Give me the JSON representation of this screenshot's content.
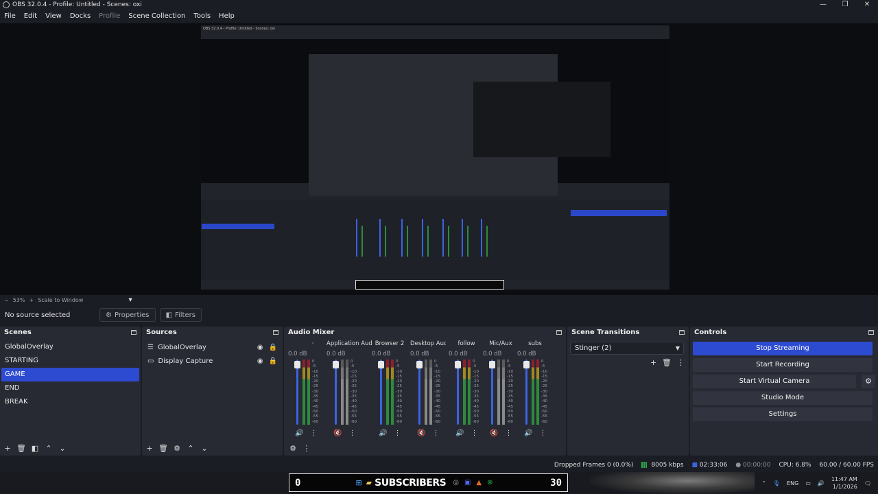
{
  "window": {
    "title": "OBS 32.0.4 - Profile: Untitled - Scenes: oxi",
    "controls": [
      "—",
      "❐",
      "✕"
    ]
  },
  "menu": [
    "File",
    "Edit",
    "View",
    "Docks",
    "Profile",
    "Scene Collection",
    "Tools",
    "Help"
  ],
  "scale": {
    "minus": "−",
    "zoom": "53%",
    "plus": "+",
    "mode": "Scale to Window"
  },
  "properties_bar": {
    "no_source": "No source selected",
    "properties": "Properties",
    "filters": "Filters"
  },
  "scenes": {
    "title": "Scenes",
    "items": [
      "GlobalOverlay",
      "STARTING",
      "GAME",
      "END",
      "BREAK"
    ],
    "selected": "GAME"
  },
  "sources": {
    "title": "Sources",
    "items": [
      {
        "name": "GlobalOverlay",
        "icon": "list-icon"
      },
      {
        "name": "Display Capture",
        "icon": "monitor-icon"
      }
    ]
  },
  "mixer": {
    "title": "Audio Mixer",
    "channels": [
      {
        "name": "·",
        "db": "0.0 dB",
        "muted": false
      },
      {
        "name": "Application Audio C",
        "db": "0.0 dB",
        "muted": true
      },
      {
        "name": "Browser 2",
        "db": "0.0 dB",
        "muted": false
      },
      {
        "name": "Desktop Audio",
        "db": "0.0 dB",
        "muted": true
      },
      {
        "name": "follow",
        "db": "0.0 dB",
        "muted": false
      },
      {
        "name": "Mic/Aux",
        "db": "0.0 dB",
        "muted": true
      },
      {
        "name": "subs",
        "db": "0.0 dB",
        "muted": false
      }
    ],
    "ticks": [
      "0",
      "-5",
      "-10",
      "-15",
      "-20",
      "-25",
      "-30",
      "-35",
      "-40",
      "-45",
      "-50",
      "-55",
      "-60"
    ]
  },
  "transitions": {
    "title": "Scene Transitions",
    "selected": "Stinger (2)"
  },
  "controls": {
    "title": "Controls",
    "buttons": [
      "Stop Streaming",
      "Start Recording",
      "Start Virtual Camera",
      "Studio Mode",
      "Settings"
    ]
  },
  "status": {
    "dropped": "Dropped Frames 0 (0.0%)",
    "bitrate": "8005 kbps",
    "stream_time": "02:33:06",
    "rec_time": "00:00:00",
    "cpu": "CPU: 6.8%",
    "fps": "60.00 / 60.00 FPS"
  },
  "overlay": {
    "left_count": "0",
    "label": "SUBSCRIBERS",
    "right_count": "30"
  },
  "tray": {
    "lang": "ENG",
    "time": "11:47 AM",
    "date": "1/1/2026"
  },
  "colors": {
    "accent": "#2d4bd1",
    "panel": "#272a33",
    "bg": "#1b1d24"
  }
}
